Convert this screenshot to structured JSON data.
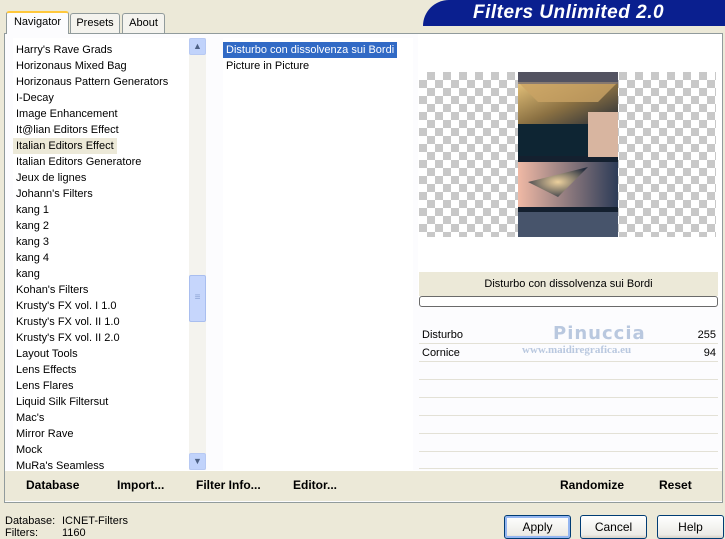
{
  "tabs": [
    {
      "label": "Navigator"
    },
    {
      "label": "Presets"
    },
    {
      "label": "About"
    }
  ],
  "app_title": "Filters Unlimited 2.0",
  "categories": [
    "Harry's Rave Grads",
    "Horizonaus Mixed Bag",
    "Horizonaus Pattern Generators",
    "I-Decay",
    "Image Enhancement",
    "It@lian Editors Effect",
    "Italian Editors Effect",
    "Italian Editors Generatore",
    "Jeux de lignes",
    "Johann's Filters",
    "kang 1",
    "kang 2",
    "kang 3",
    "kang 4",
    "kang",
    "Kohan's Filters",
    "Krusty's FX vol. I 1.0",
    "Krusty's FX vol. II 1.0",
    "Krusty's FX vol. II 2.0",
    "Layout Tools",
    "Lens Effects",
    "Lens Flares",
    "Liquid Silk Filtersut",
    "Mac's",
    "Mirror Rave",
    "Mock",
    "MuRa's Seamless"
  ],
  "selected_category": "Italian Editors Effect",
  "filters": [
    "Disturbo con dissolvenza sui Bordi",
    "Picture in Picture"
  ],
  "selected_filter": "Disturbo con dissolvenza sui Bordi",
  "current_filter_name": "Disturbo con dissolvenza sui Bordi",
  "params": [
    {
      "name": "Disturbo",
      "value": "255"
    },
    {
      "name": "Cornice",
      "value": "94"
    }
  ],
  "watermark": {
    "line1": "Pinuccia",
    "line2": "www.maidiregrafica.eu"
  },
  "bottom_buttons": {
    "database": "Database",
    "import": "Import...",
    "filter_info": "Filter Info...",
    "editor": "Editor...",
    "randomize": "Randomize",
    "reset": "Reset"
  },
  "dialog_buttons": {
    "apply": "Apply",
    "cancel": "Cancel",
    "help": "Help"
  },
  "status": {
    "database_label": "Database:",
    "database_value": "ICNET-Filters",
    "filters_label": "Filters:",
    "filters_value": "1160"
  },
  "colors": {
    "selection": "#316AC5",
    "banner": "#0A1F8F",
    "window_bg": "#ECE9D8"
  }
}
